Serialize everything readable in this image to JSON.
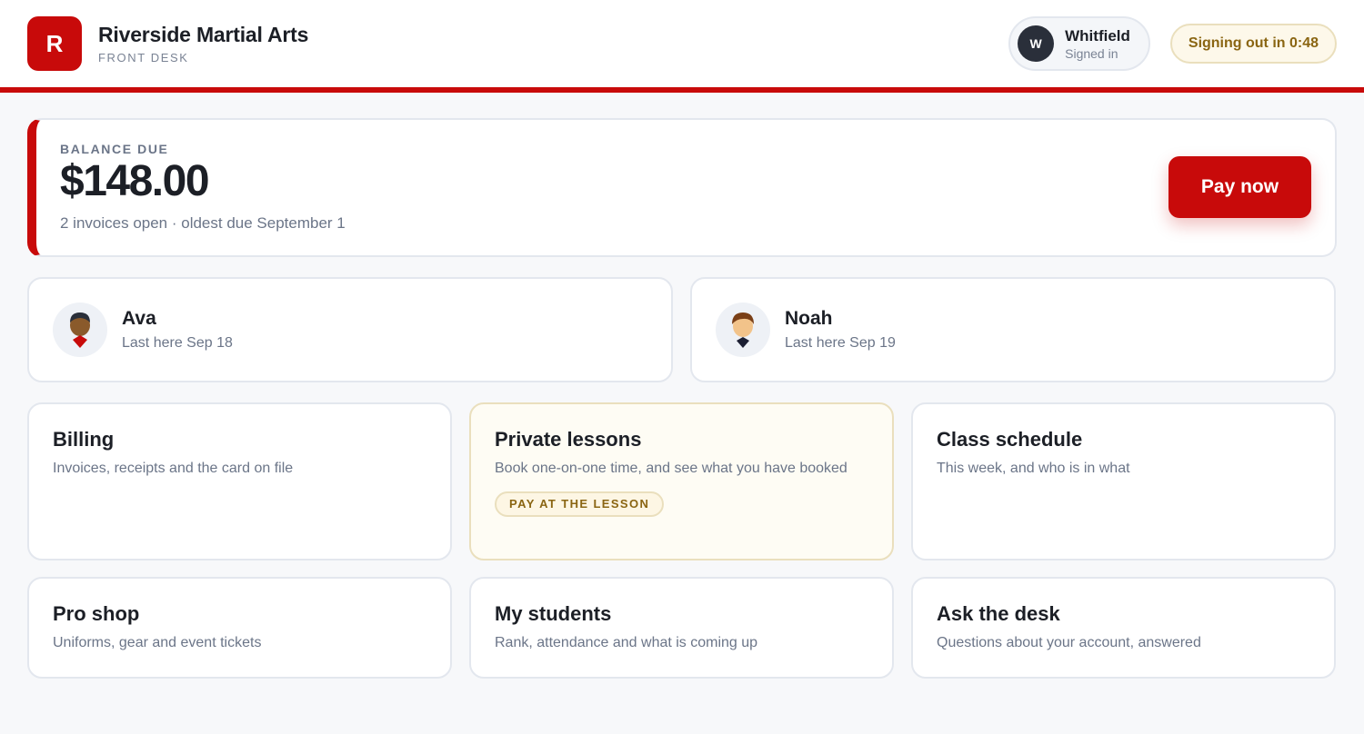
{
  "header": {
    "logo_letter": "R",
    "brand_name": "Riverside Martial Arts",
    "brand_sub": "FRONT DESK",
    "user": {
      "initial": "W",
      "name": "Whitfield",
      "status": "Signed in"
    },
    "timer_label": "Signing out in 0:48"
  },
  "balance": {
    "label": "BALANCE DUE",
    "amount": "$148.00",
    "note": "2 invoices open · oldest due September 1",
    "pay_label": "Pay now"
  },
  "students": [
    {
      "name": "Ava",
      "last_seen": "Last here Sep 18"
    },
    {
      "name": "Noah",
      "last_seen": "Last here Sep 19"
    }
  ],
  "tiles": [
    {
      "title": "Billing",
      "desc": "Invoices, receipts and the card on file"
    },
    {
      "title": "Private lessons",
      "desc": "Book one-on-one time, and see what you have booked",
      "badge": "PAY AT THE LESSON"
    },
    {
      "title": "Class schedule",
      "desc": "This week, and who is in what"
    },
    {
      "title": "Pro shop",
      "desc": "Uniforms, gear and event tickets"
    },
    {
      "title": "My students",
      "desc": "Rank, attendance and what is coming up"
    },
    {
      "title": "Ask the desk",
      "desc": "Questions about your account, answered"
    }
  ],
  "colors": {
    "brand": "#c80a0a",
    "badge_text": "#8a6512",
    "muted_text": "#6b7588"
  }
}
